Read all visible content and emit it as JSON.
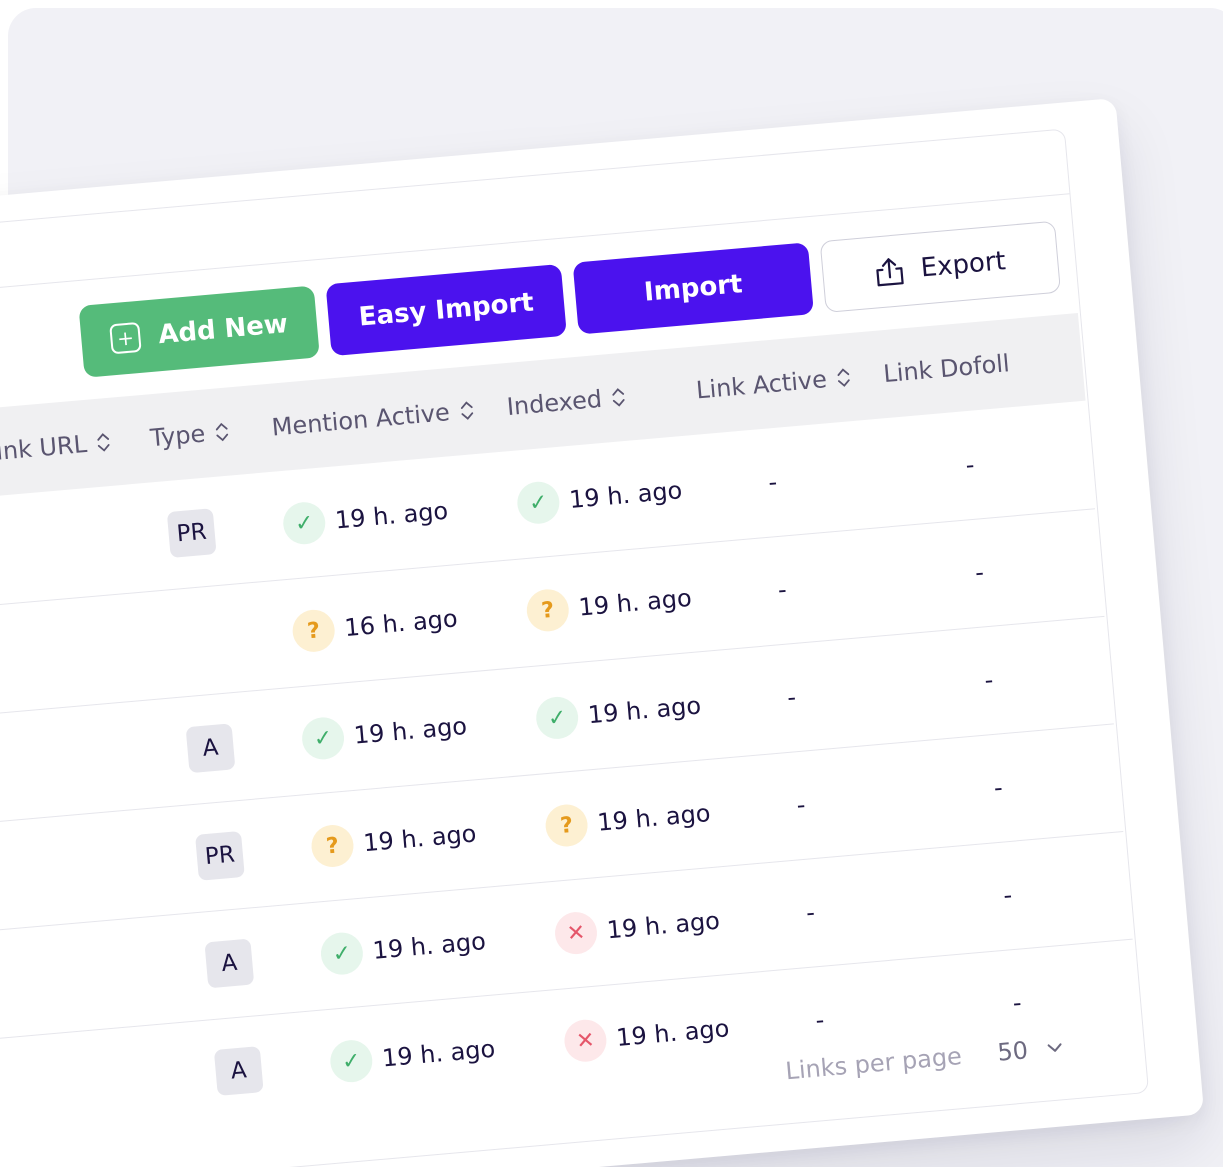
{
  "toolbar": {
    "add_new_label": "Add New",
    "easy_import_label": "Easy Import",
    "import_label": "Import",
    "export_label": "Export"
  },
  "columns": [
    {
      "key": "link_url",
      "label": "Link URL"
    },
    {
      "key": "type",
      "label": "Type"
    },
    {
      "key": "mention_active",
      "label": "Mention Active"
    },
    {
      "key": "indexed",
      "label": "Indexed"
    },
    {
      "key": "link_active",
      "label": "Link Active"
    },
    {
      "key": "link_dofollow",
      "label": "Link Dofoll"
    }
  ],
  "rows": [
    {
      "type": "PR",
      "mention": {
        "status": "ok",
        "time": "19 h. ago"
      },
      "indexed": {
        "status": "ok",
        "time": "19 h. ago"
      },
      "link_active": "-",
      "link_dofollow": "-"
    },
    {
      "type": "",
      "mention": {
        "status": "unknown",
        "time": "16 h. ago"
      },
      "indexed": {
        "status": "unknown",
        "time": "19 h. ago"
      },
      "link_active": "-",
      "link_dofollow": "-"
    },
    {
      "type": "A",
      "mention": {
        "status": "ok",
        "time": "19 h. ago"
      },
      "indexed": {
        "status": "ok",
        "time": "19 h. ago"
      },
      "link_active": "-",
      "link_dofollow": "-"
    },
    {
      "type": "PR",
      "mention": {
        "status": "unknown",
        "time": "19 h. ago"
      },
      "indexed": {
        "status": "unknown",
        "time": "19 h. ago"
      },
      "link_active": "-",
      "link_dofollow": "-"
    },
    {
      "type": "A",
      "mention": {
        "status": "ok",
        "time": "19 h. ago"
      },
      "indexed": {
        "status": "error",
        "time": "19 h. ago"
      },
      "link_active": "-",
      "link_dofollow": "-"
    },
    {
      "type": "A",
      "mention": {
        "status": "ok",
        "time": "19 h. ago"
      },
      "indexed": {
        "status": "error",
        "time": "19 h. ago"
      },
      "link_active": "-",
      "link_dofollow": "-"
    }
  ],
  "status_icons": {
    "ok": "check-icon",
    "unknown": "question-icon",
    "error": "x-icon"
  },
  "colors": {
    "green": "#55bb7a",
    "purple": "#4b12ee",
    "ok": "#3fae6a",
    "unknown": "#e59a1c",
    "error": "#e5566a"
  },
  "pagination": {
    "label": "Links per page",
    "value": "50"
  }
}
